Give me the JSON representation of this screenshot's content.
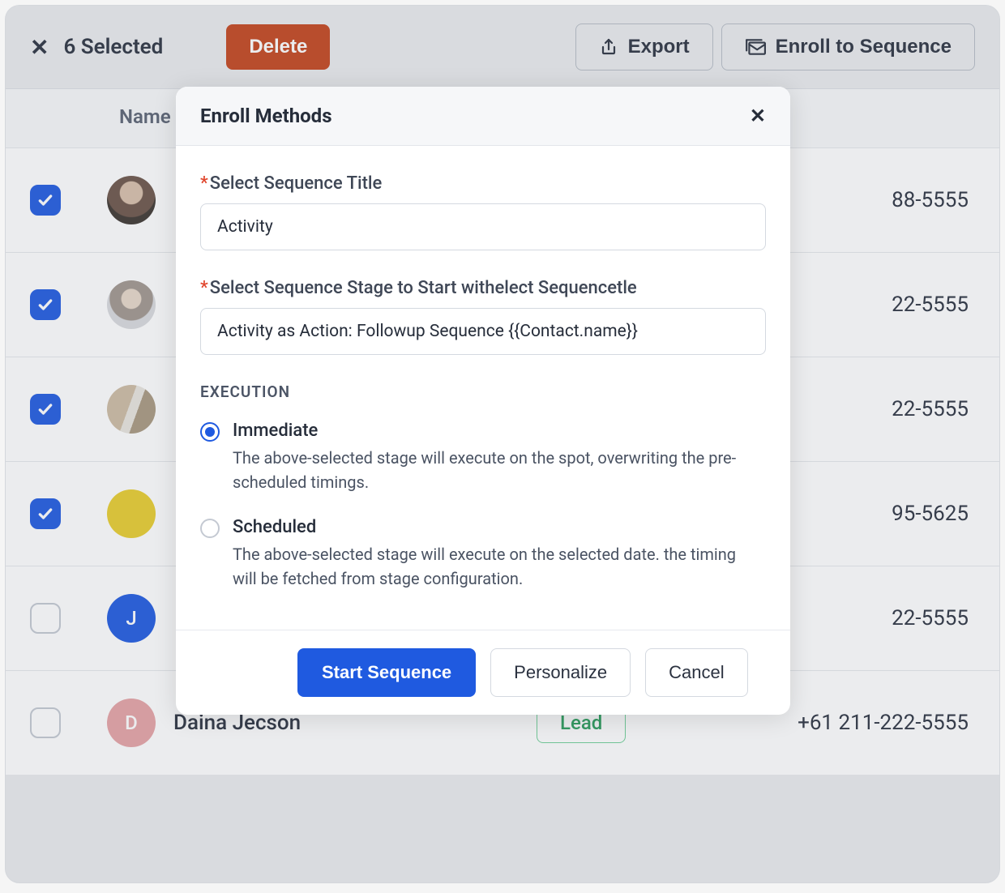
{
  "topbar": {
    "selected_label": "6 Selected",
    "delete_label": "Delete",
    "export_label": "Export",
    "enroll_label": "Enroll to Sequence"
  },
  "table": {
    "header_name": "Name",
    "rows": [
      {
        "checked": true,
        "avatar_bg": "#8d7b7a",
        "avatar_letter": "",
        "name": "",
        "tag": "",
        "phone": "88-5555",
        "avatar_type": "photo1"
      },
      {
        "checked": true,
        "avatar_bg": "#cfcac5",
        "avatar_letter": "",
        "name": "",
        "tag": "",
        "phone": "22-5555",
        "avatar_type": "photo2"
      },
      {
        "checked": true,
        "avatar_bg": "#b9a493",
        "avatar_letter": "",
        "name": "",
        "tag": "",
        "phone": "22-5555",
        "avatar_type": "photo3"
      },
      {
        "checked": true,
        "avatar_bg": "#e8cd2d",
        "avatar_letter": "",
        "name": "",
        "tag": "",
        "phone": "95-5625",
        "avatar_type": "solid"
      },
      {
        "checked": false,
        "avatar_bg": "#1f5ae0",
        "avatar_letter": "J",
        "name": "",
        "tag": "",
        "phone": "22-5555",
        "avatar_type": "letter"
      },
      {
        "checked": false,
        "avatar_bg": "#e6a3a5",
        "avatar_letter": "D",
        "name": "Daina Jecson",
        "tag": "Lead",
        "phone": "+61 211-222-5555",
        "avatar_type": "letter"
      }
    ]
  },
  "modal": {
    "title": "Enroll Methods",
    "field1_label": "Select Sequence Title",
    "field1_value": "Activity",
    "field2_label": "Select Sequence Stage to Start withelect Sequencetle",
    "field2_value": "Activity as Action: Followup Sequence {{Contact.name}}",
    "execution_label": "EXECUTION",
    "immediate_label": "Immediate",
    "immediate_desc": "The above-selected stage will execute on the spot, overwriting the pre-scheduled timings.",
    "scheduled_label": "Scheduled",
    "scheduled_desc": "The above-selected stage will execute on the selected date. the timing will be fetched from stage configuration.",
    "btn_start": "Start Sequence",
    "btn_personalize": "Personalize",
    "btn_cancel": "Cancel"
  }
}
